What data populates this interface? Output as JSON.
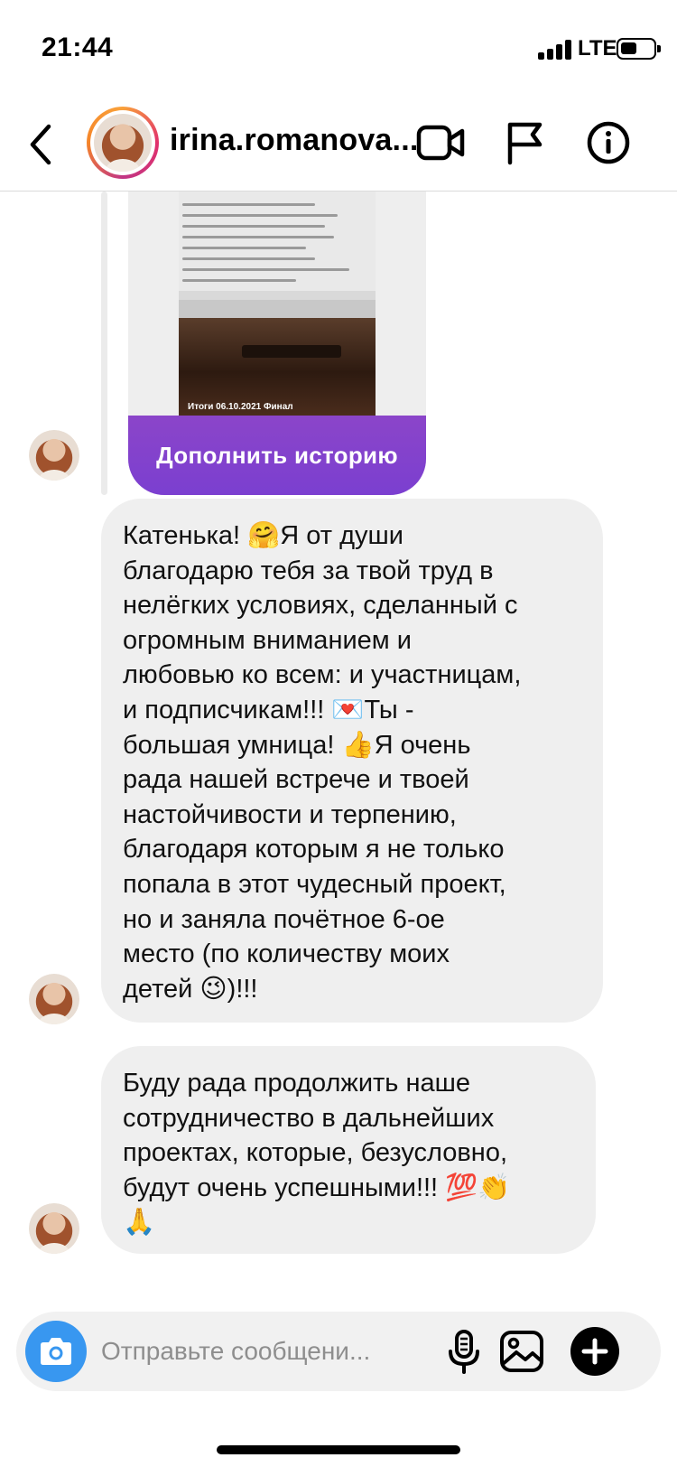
{
  "status_bar": {
    "time": "21:44",
    "network": "LTE"
  },
  "header": {
    "username": "irina.romanova..."
  },
  "story": {
    "caption": "Итоги 06.10.2021 Финал",
    "button_label": "Дополнить историю"
  },
  "messages": [
    {
      "text": "Катенька! 🤗Я от души\nблагодарю тебя за твой труд в\nнелёгких условиях, сделанный с\nогромным вниманием и\nлюбовью ко всем: и участницам,\nи подписчикам!!! 💌Ты -\nбольшая умница! 👍Я очень\nрада нашей встрече и твоей\nнастойчивости и терпению,\nблагодаря которым я не только\nпопала в этот чудесный проект,\nно и заняла почётное 6-ое\nместо (по количеству моих\nдетей 😉)!!!"
    },
    {
      "text": "Буду рада продолжить наше\nсотрудничество в дальнейших\nпроектах, которые, безусловно,\nбудут очень успешными!!! 💯👏\n🙏"
    }
  ],
  "composer": {
    "placeholder": "Отправьте сообщени..."
  },
  "icons": {
    "back": "chevron-left-icon",
    "video": "video-camera-icon",
    "report": "flag-icon",
    "info": "info-icon",
    "camera": "camera-icon",
    "mic": "microphone-icon",
    "gallery": "image-icon",
    "plus": "plus-icon"
  },
  "colors": {
    "story_button": "#7b3fd0",
    "bubble": "#efefef",
    "camera_button": "#3897f0",
    "placeholder": "#8e8e8e"
  }
}
